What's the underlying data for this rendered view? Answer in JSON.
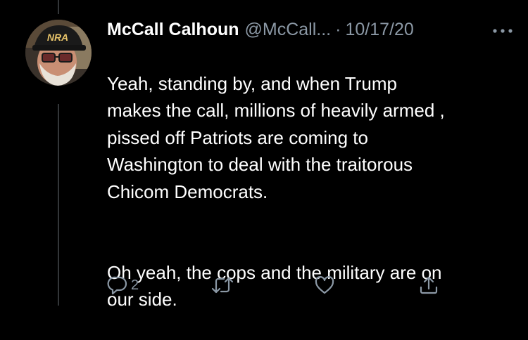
{
  "tweet": {
    "author": {
      "display_name": "McCall Calhoun",
      "handle": "@McCall...",
      "avatar_hat_text": "NRA"
    },
    "separator": "·",
    "timestamp": "10/17/20",
    "text_paragraphs": [
      "Yeah, standing by, and when Trump\nmakes the call, millions of heavily armed ,\npissed off Patriots are coming to\nWashington to deal with the traitorous\nChicom Democrats.",
      "Oh yeah, the cops and the military are on\nour side."
    ],
    "actions": {
      "reply_count": "2",
      "retweet_count": "",
      "like_count": ""
    }
  },
  "icons": {
    "more": "more-horizontal-icon",
    "reply": "reply-bubble-icon",
    "retweet": "retweet-icon",
    "like": "heart-icon",
    "share": "share-icon"
  },
  "colors": {
    "background": "#000000",
    "text_primary": "#ffffff",
    "text_secondary": "#8b98a5",
    "thread_line": "#333639"
  }
}
